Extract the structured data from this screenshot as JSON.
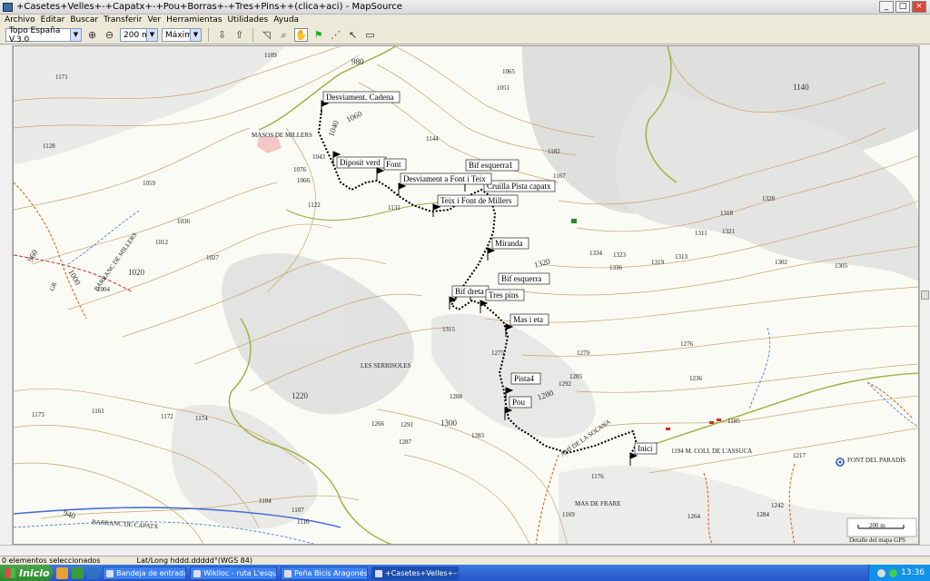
{
  "window": {
    "title": "+Casetes+Velles+-+Capatx+-+Pou+Borras+-+Tres+Pins++(clica+aci) - MapSource",
    "buttons": [
      "_",
      "□",
      "×"
    ]
  },
  "menu": [
    "Archivo",
    "Editar",
    "Buscar",
    "Transferir",
    "Ver",
    "Herramientas",
    "Utilidades",
    "Ayuda"
  ],
  "toolbar": {
    "map_product": "Topo España V.3.0",
    "zoom": "200 m",
    "detail": "Máximo"
  },
  "map": {
    "waypoints": [
      {
        "label": "Desviament. Cadena"
      },
      {
        "label": "Diposit verd"
      },
      {
        "label": "Font"
      },
      {
        "label": "Bif esquerra1"
      },
      {
        "label": "Cruilla Pista capatx"
      },
      {
        "label": "Desviament a Font i Teix"
      },
      {
        "label": "Teix i Font de Millers"
      },
      {
        "label": "Miranda"
      },
      {
        "label": "Bif esquerra"
      },
      {
        "label": "Bif dreta"
      },
      {
        "label": "Tres pins"
      },
      {
        "label": "Mas i eta"
      },
      {
        "label": "Pista4"
      },
      {
        "label": "Pou"
      },
      {
        "label": "Inici"
      }
    ],
    "place_names": [
      "MASOS DE MILLERS",
      "LES SERRISOLES",
      "AMÍ DE LA SOLANA",
      "1194 M.  COLL DE L'ASSUCA",
      "MAS DE FRARE",
      "FONT DEL PARADÍS",
      "BARRANC DE CAPATX",
      "BARRANC DE MILLERS",
      "GR"
    ],
    "contour_labels": [
      "1060",
      "1040",
      "1140",
      "1020",
      "1320",
      "1280",
      "1300",
      "1220",
      "960",
      "940",
      "1000",
      "980"
    ],
    "spot_heights": [
      "1109",
      "1171",
      "1065",
      "1051",
      "1128",
      "1144",
      "1182",
      "1167",
      "1043",
      "1076",
      "1066",
      "1059",
      "1122",
      "1131",
      "1036",
      "1012",
      "1027",
      "1004",
      "1328",
      "1318",
      "1311",
      "1321",
      "1334",
      "1323",
      "1336",
      "1319",
      "1313",
      "1302",
      "1305",
      "1315",
      "1275",
      "1279",
      "1276",
      "1285",
      "1292",
      "1236",
      "1288",
      "1266",
      "1291",
      "1283",
      "1287",
      "1173",
      "1161",
      "1172",
      "1174",
      "1176",
      "1169",
      "1104",
      "1107",
      "1116",
      "1185",
      "1217",
      "1242",
      "1264",
      "1284"
    ],
    "scale_label": "200 m",
    "detail_caption": "Detalle del mapa GPS"
  },
  "status": {
    "selection": "0 elementos seleccionados",
    "coords": "Lat/Long hddd.ddddd°(WGS 84)"
  },
  "taskbar": {
    "start": "Inicio",
    "tasks": [
      "Bandeja de entrada - ...",
      "Wikiloc - ruta L'esquer...",
      "Peña Bicis Aragonés: ...",
      "+Casetes+Velles+-+..."
    ],
    "clock": "13:36"
  }
}
